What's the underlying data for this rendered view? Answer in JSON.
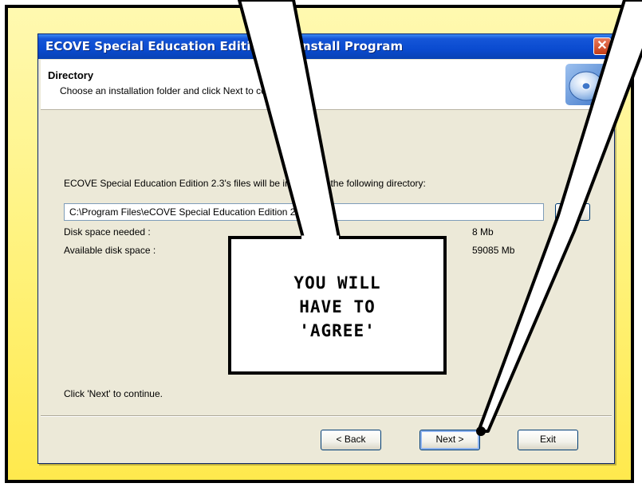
{
  "window": {
    "title": "ECOVE Special Education Edition 2.3 Install Program",
    "close_glyph": "✕"
  },
  "header": {
    "title": "Directory",
    "subtitle": "Choose an installation folder and click Next to continue.",
    "icon": "cd-icon"
  },
  "main": {
    "install_text": "ECOVE Special Education Edition 2.3's files will be installed in the following directory:",
    "path_value": "C:\\Program Files\\eCOVE Special Education Edition 2.3",
    "browse_label": "...",
    "disk_needed_label": "Disk space needed :",
    "disk_needed_value": "8 Mb",
    "disk_available_label": "Available disk space :",
    "disk_available_value": "59085 Mb",
    "footer_text": "Click 'Next' to continue."
  },
  "buttons": {
    "back": "< Back",
    "next": "Next >",
    "exit": "Exit"
  },
  "callout": {
    "text": "YOU WILL\nHAVE TO\n'AGREE'"
  },
  "colors": {
    "panel_background": "#fff27a",
    "titlebar": "#0a4bd0",
    "dialog_face": "#ece9d8"
  }
}
